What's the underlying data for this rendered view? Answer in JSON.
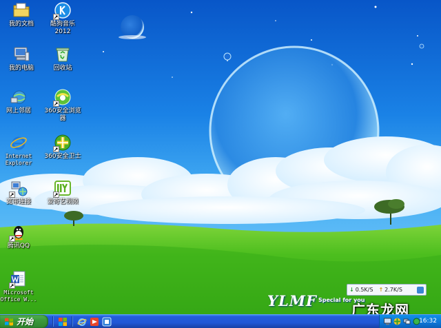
{
  "desktop": {
    "icons": [
      {
        "label": "我的文档",
        "icon": "my-documents-icon"
      },
      {
        "label": "酷狗音乐\n2012",
        "icon": "kugou-music-icon"
      },
      {
        "label": "我的电脑",
        "icon": "my-computer-icon"
      },
      {
        "label": "回收站",
        "icon": "recycle-bin-icon"
      },
      {
        "label": "网上邻居",
        "icon": "network-places-icon"
      },
      {
        "label": "360安全浏览\n器",
        "icon": "360-browser-icon"
      },
      {
        "label": "Internet\nExplorer",
        "icon": "internet-explorer-icon"
      },
      {
        "label": "360安全卫士",
        "icon": "360-safeguard-icon"
      },
      {
        "label": "宽带连接",
        "icon": "broadband-connection-icon"
      },
      {
        "label": "爱奇艺视频",
        "icon": "iqiyi-video-icon"
      },
      {
        "label": "腾讯QQ",
        "icon": "qq-icon"
      },
      {
        "label": "Microsoft\nOffice W...",
        "icon": "word-icon"
      }
    ]
  },
  "net_monitor": {
    "download": "0.5K/S",
    "upload": "2.7K/S"
  },
  "branding": {
    "logo": "YLMF",
    "tagline": "Special for you",
    "watermark": "广东龙网"
  },
  "taskbar": {
    "start_label": "开始",
    "quick_launch": [
      {
        "icon": "show-desktop-icon"
      },
      {
        "icon": "ie-quick-launch-icon"
      },
      {
        "icon": "media-player-icon"
      },
      {
        "icon": "app-quick-launch-icon"
      }
    ],
    "clock": "16:32"
  },
  "colors": {
    "sky_top": "#0a62d8",
    "sky_mid": "#2b9af0",
    "grass": "#3fb61a",
    "taskbar_blue": "#245edb",
    "start_green": "#3c9a3c"
  }
}
